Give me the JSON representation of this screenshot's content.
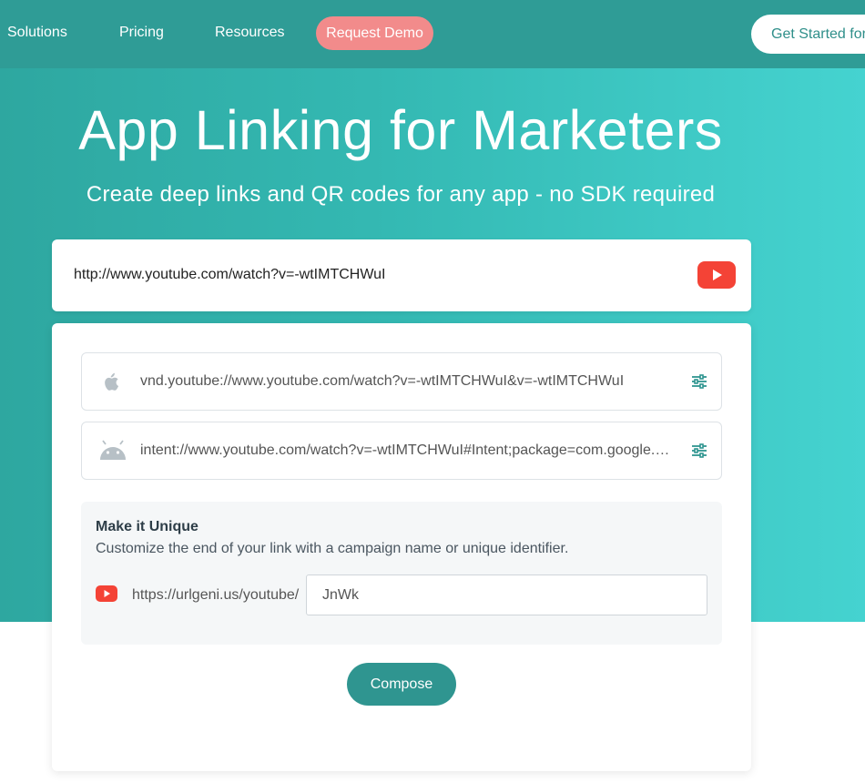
{
  "nav": {
    "solutions": "Solutions",
    "pricing": "Pricing",
    "resources": "Resources",
    "request_demo": "Request Demo",
    "get_started": "Get Started for"
  },
  "hero": {
    "title": "App Linking for Marketers",
    "subtitle": "Create deep links and QR codes for any app - no SDK required"
  },
  "url_input": {
    "value": "http://www.youtube.com/watch?v=-wtIMTCHWuI",
    "icon": "youtube-icon"
  },
  "links": {
    "ios": {
      "icon": "apple-icon",
      "value": "vnd.youtube://www.youtube.com/watch?v=-wtIMTCHWuI&v=-wtIMTCHWuI"
    },
    "android": {
      "icon": "android-icon",
      "value": "intent://www.youtube.com/watch?v=-wtIMTCHWuI#Intent;package=com.google.android.youtube;scheme=https;end"
    }
  },
  "unique": {
    "title": "Make it Unique",
    "description": "Customize the end of your link with a campaign name or unique identifier.",
    "prefix": "https://urlgeni.us/youtube/",
    "slug_value": "JnWk"
  },
  "compose_label": "Compose",
  "colors": {
    "nav_bg": "#2f9c96",
    "accent_teal": "#2f9590",
    "demo_pink": "#f28b8b",
    "youtube_red": "#f44336"
  }
}
